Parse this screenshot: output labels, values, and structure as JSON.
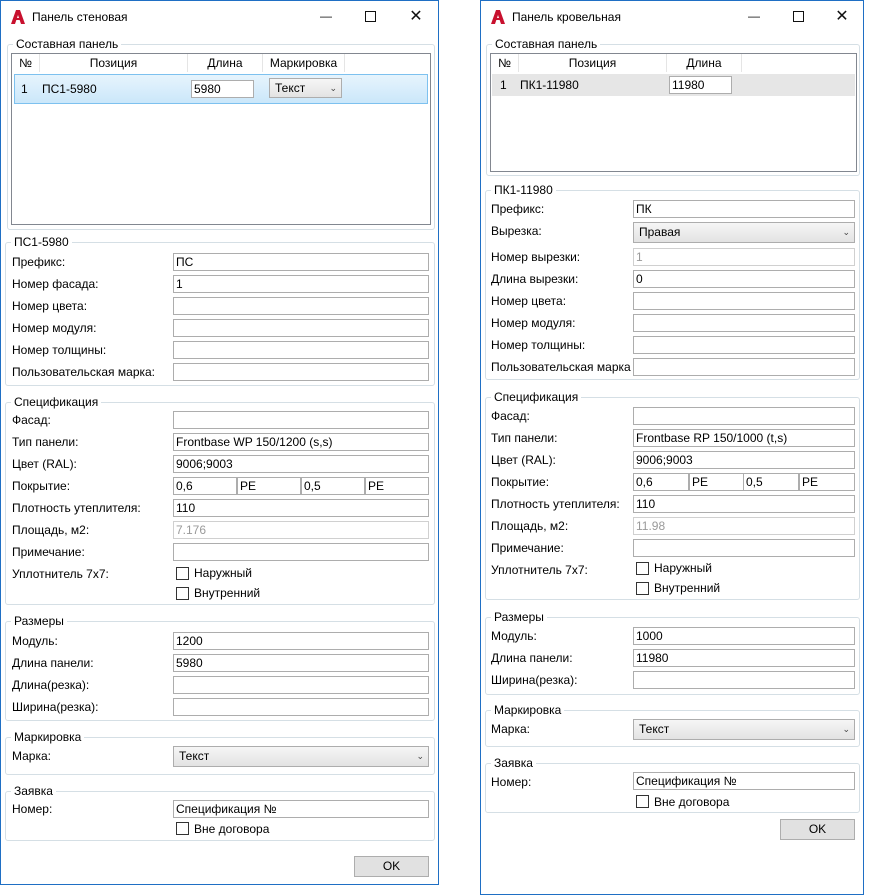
{
  "wall": {
    "title": "Панель стеновая",
    "composite": {
      "group": "Составная панель",
      "headers": {
        "num": "№",
        "pos": "Позиция",
        "len": "Длина",
        "mark": "Маркировка"
      },
      "row": {
        "num": "1",
        "pos": "ПС1-5980",
        "len": "5980",
        "mark": "Текст"
      }
    },
    "panel": {
      "group": "ПС1-5980",
      "prefix_label": "Префикс:",
      "prefix": "ПС",
      "facade_num_label": "Номер фасада:",
      "facade_num": "1",
      "color_num_label": "Номер цвета:",
      "color_num": "",
      "module_num_label": "Номер модуля:",
      "module_num": "",
      "thick_num_label": "Номер толщины:",
      "thick_num": "",
      "user_mark_label": "Пользовательская марка:",
      "user_mark": ""
    },
    "spec": {
      "group": "Спецификация",
      "facade_label": "Фасад:",
      "facade": "",
      "type_label": "Тип панели:",
      "type": "Frontbase WP 150/1200 (s,s)",
      "color_label": "Цвет (RAL):",
      "color": "9006;9003",
      "coating_label": "Покрытие:",
      "coat1": "0,6",
      "coat2": "PE",
      "coat3": "0,5",
      "coat4": "PE",
      "density_label": "Плотность утеплителя:",
      "density": "110",
      "area_label": "Площадь, м2:",
      "area": "7.176",
      "note_label": "Примечание:",
      "note": "",
      "seal_label": "Уплотнитель 7х7:",
      "seal_outer": "Наружный",
      "seal_inner": "Внутренний"
    },
    "sizes": {
      "group": "Размеры",
      "module_label": "Модуль:",
      "module": "1200",
      "length_label": "Длина панели:",
      "length": "5980",
      "cut_len_label": "Длина(резка):",
      "cut_len": "",
      "cut_width_label": "Ширина(резка):",
      "cut_width": ""
    },
    "marking": {
      "group": "Маркировка",
      "mark_label": "Марка:",
      "mark": "Текст"
    },
    "order": {
      "group": "Заявка",
      "num_label": "Номер:",
      "num": "Спецификация №",
      "outside": "Вне договора"
    },
    "ok": "OK"
  },
  "roof": {
    "title": "Панель кровельная",
    "composite": {
      "group": "Составная панель",
      "headers": {
        "num": "№",
        "pos": "Позиция",
        "len": "Длина"
      },
      "row": {
        "num": "1",
        "pos": "ПК1-11980",
        "len": "11980"
      }
    },
    "panel": {
      "group": "ПК1-11980",
      "prefix_label": "Префикс:",
      "prefix": "ПК",
      "cutout_label": "Вырезка:",
      "cutout": "Правая",
      "cutout_num_label": "Номер вырезки:",
      "cutout_num": "1",
      "cutout_len_label": "Длина вырезки:",
      "cutout_len": "0",
      "color_num_label": "Номер цвета:",
      "color_num": "",
      "module_num_label": "Номер модуля:",
      "module_num": "",
      "thick_num_label": "Номер толщины:",
      "thick_num": "",
      "user_mark_label": "Пользовательская марка",
      "user_mark": ""
    },
    "spec": {
      "group": "Спецификация",
      "facade_label": "Фасад:",
      "facade": "",
      "type_label": "Тип панели:",
      "type": "Frontbase RP 150/1000 (t,s)",
      "color_label": "Цвет (RAL):",
      "color": "9006;9003",
      "coating_label": "Покрытие:",
      "coat1": "0,6",
      "coat2": "PE",
      "coat3": "0,5",
      "coat4": "PE",
      "density_label": "Плотность утеплителя:",
      "density": "110",
      "area_label": "Площадь, м2:",
      "area": "11.98",
      "note_label": "Примечание:",
      "note": "",
      "seal_label": "Уплотнитель 7х7:",
      "seal_outer": "Наружный",
      "seal_inner": "Внутренний"
    },
    "sizes": {
      "group": "Размеры",
      "module_label": "Модуль:",
      "module": "1000",
      "length_label": "Длина панели:",
      "length": "11980",
      "cut_width_label": "Ширина(резка):",
      "cut_width": ""
    },
    "marking": {
      "group": "Маркировка",
      "mark_label": "Марка:",
      "mark": "Текст"
    },
    "order": {
      "group": "Заявка",
      "num_label": "Номер:",
      "num": "Спецификация №",
      "outside": "Вне договора"
    },
    "ok": "OK"
  }
}
